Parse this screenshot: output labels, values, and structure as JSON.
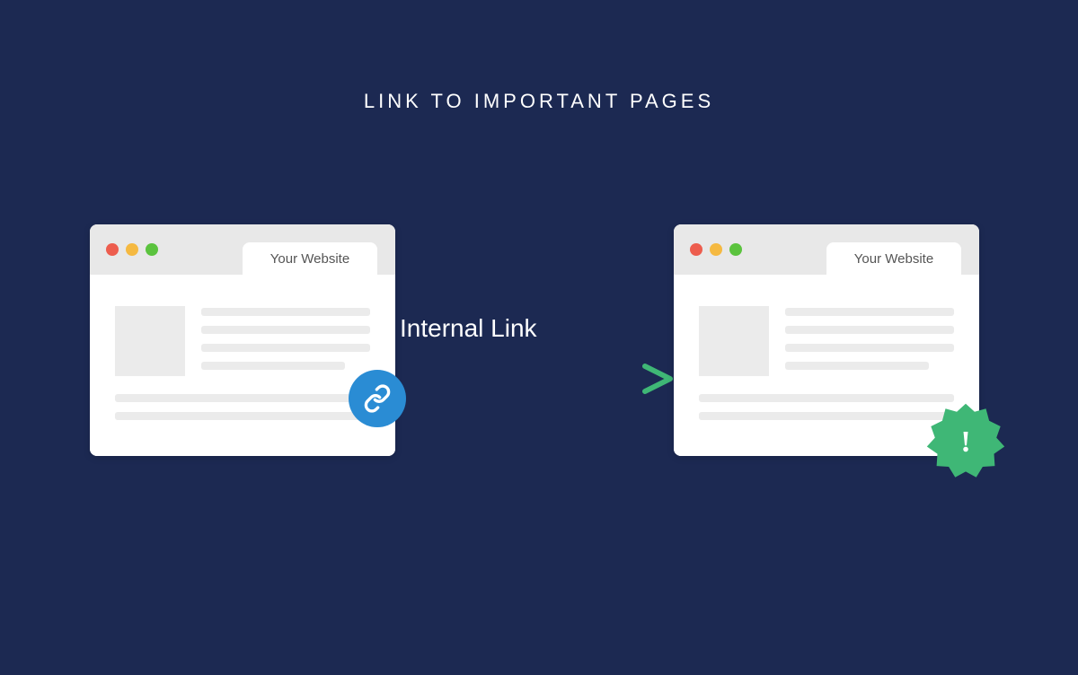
{
  "title": "LINK TO IMPORTANT PAGES",
  "arrow_label": "Internal Link",
  "left_window": {
    "tab_label": "Your Website",
    "link_icon": "link-icon"
  },
  "right_window": {
    "tab_label": "Your Website",
    "badge_text": "!"
  },
  "colors": {
    "background": "#1c2952",
    "link_badge": "#2a8cd4",
    "starburst": "#3fb776",
    "arrow_start": "#2a8cd4",
    "arrow_end": "#3fb776"
  }
}
